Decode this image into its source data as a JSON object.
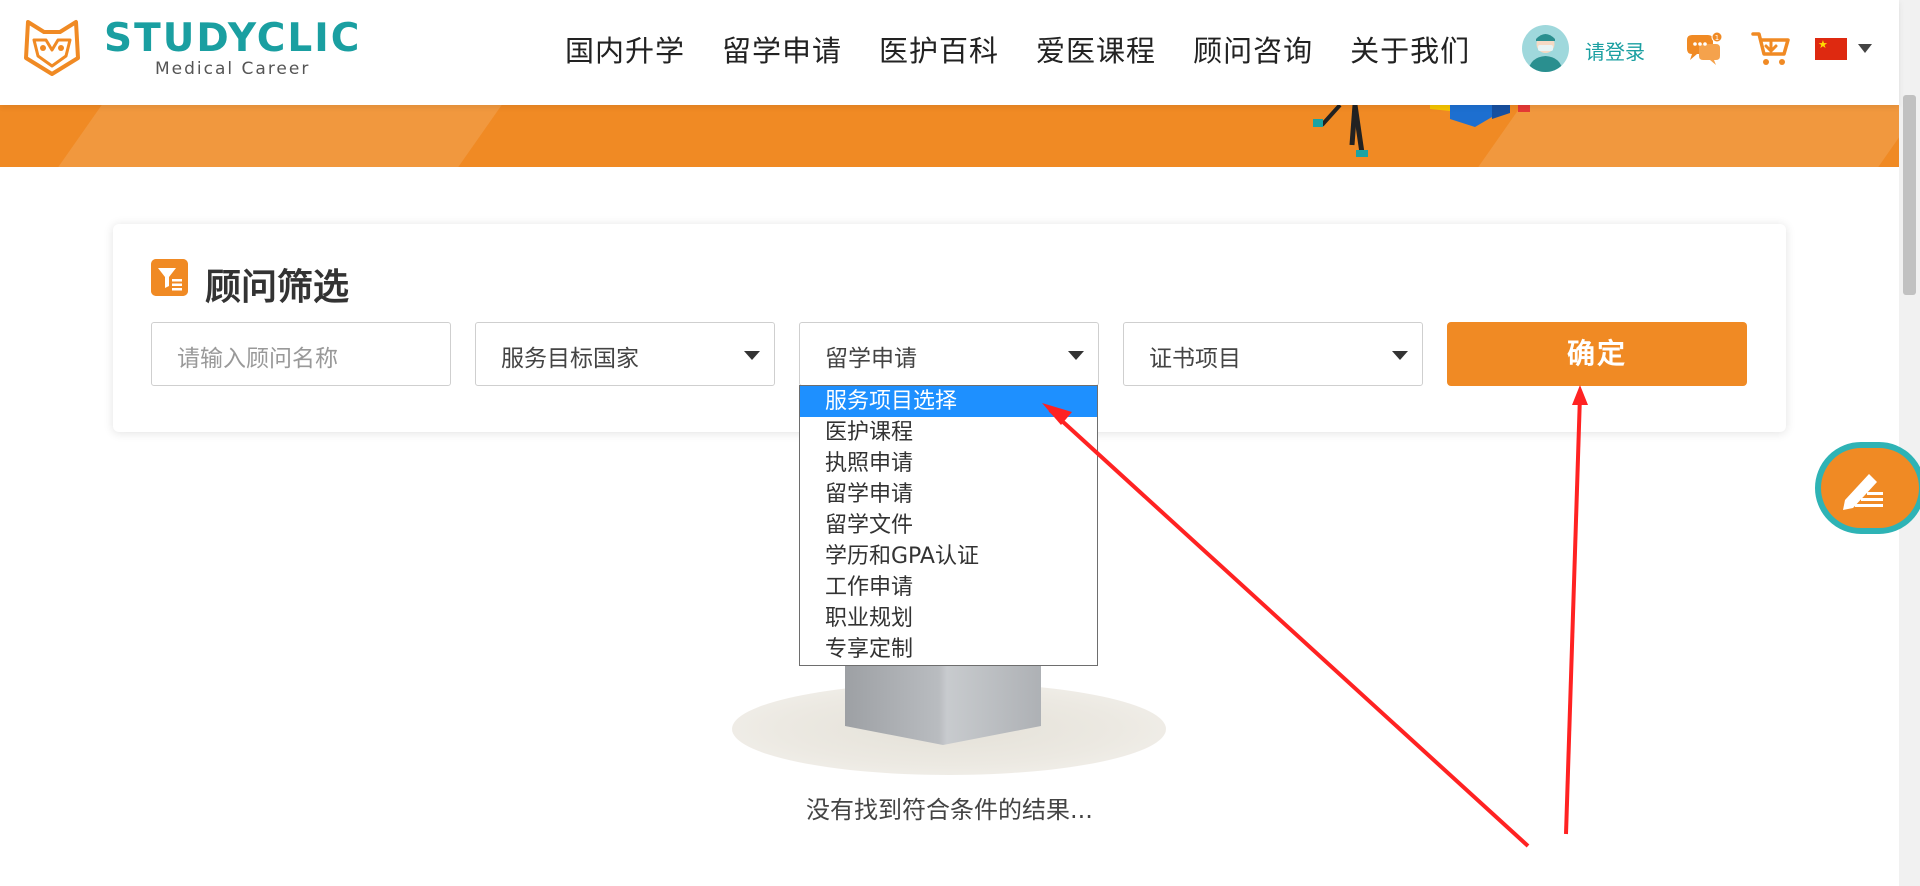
{
  "header": {
    "logo": {
      "title": "STUDYCLIC",
      "subtitle": "Medical Career"
    },
    "nav": [
      "国内升学",
      "留学申请",
      "医护百科",
      "爱医课程",
      "顾问咨询",
      "关于我们"
    ],
    "login_label": "请登录",
    "chat_badge": "1",
    "language_icon": "china-flag-icon"
  },
  "filter": {
    "title": "顾问筛选",
    "name_input": {
      "value": "",
      "placeholder": "请输入顾问名称"
    },
    "country_select": {
      "selected": "服务目标国家"
    },
    "service_select": {
      "selected": "留学申请",
      "options": [
        "服务项目选择",
        "医护课程",
        "执照申请",
        "留学申请",
        "留学文件",
        "学历和GPA认证",
        "工作申请",
        "职业规划",
        "专享定制"
      ],
      "highlighted_index": 0
    },
    "certificate_select": {
      "selected": "证书项目"
    },
    "confirm_label": "确定"
  },
  "empty_state": {
    "message": "没有找到符合条件的结果..."
  },
  "colors": {
    "brand_teal": "#1a9fa1",
    "accent_orange": "#f08a24",
    "highlight_blue": "#1e90ff",
    "annotation_red": "#ff2222"
  }
}
